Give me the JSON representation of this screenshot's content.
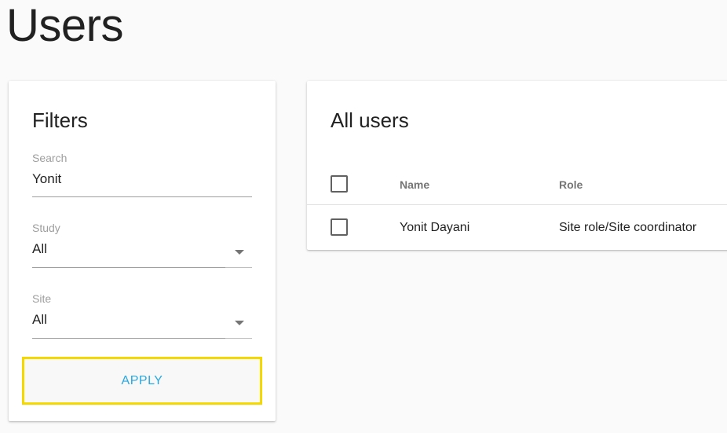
{
  "page": {
    "title": "Users"
  },
  "filters": {
    "title": "Filters",
    "search": {
      "label": "Search",
      "value": "Yonit"
    },
    "study": {
      "label": "Study",
      "value": "All"
    },
    "site": {
      "label": "Site",
      "value": "All"
    },
    "apply_label": "APPLY",
    "highlight_color": "#f5d800",
    "accent_color": "#29a8e0"
  },
  "users": {
    "title": "All users",
    "columns": [
      "Name",
      "Role"
    ],
    "rows": [
      {
        "name": "Yonit Dayani",
        "role": "Site role/Site coordinator",
        "checked": false
      }
    ],
    "select_all_checked": false
  }
}
